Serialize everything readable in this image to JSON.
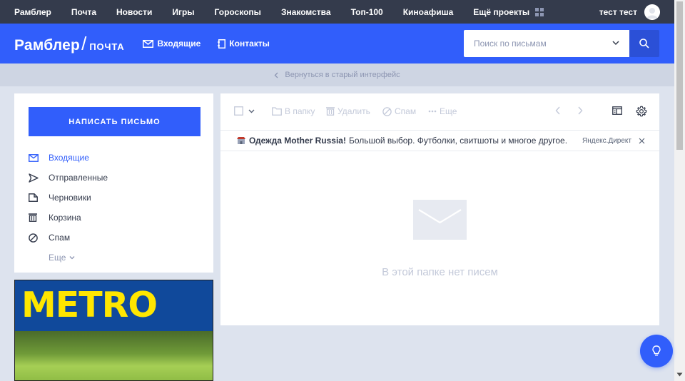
{
  "portal_bar": {
    "links": [
      "Рамблер",
      "Почта",
      "Новости",
      "Игры",
      "Гороскопы",
      "Знакомства",
      "Топ-100",
      "Киноафиша"
    ],
    "more_projects": "Ещё проекты",
    "user_name": "тест тест"
  },
  "header": {
    "logo_main": "Рамблер",
    "logo_slash": "/",
    "logo_sub": "почта",
    "nav_inbox": "Входящие",
    "nav_contacts": "Контакты",
    "search_placeholder": "Поиск по письмам"
  },
  "back_link": "Вернуться в старый интерфейс",
  "sidebar": {
    "compose": "НАПИСАТЬ ПИСЬМО",
    "folders": [
      {
        "label": "Входящие",
        "icon": "envelope-icon"
      },
      {
        "label": "Отправленные",
        "icon": "send-icon"
      },
      {
        "label": "Черновики",
        "icon": "draft-icon"
      },
      {
        "label": "Корзина",
        "icon": "trash-icon"
      },
      {
        "label": "Спам",
        "icon": "spam-icon"
      }
    ],
    "more": "Еще"
  },
  "ad_banner": {
    "text": "METRO"
  },
  "toolbar": {
    "to_folder": "В папку",
    "delete": "Удалить",
    "spam": "Спам",
    "more": "Еще"
  },
  "direct_ad": {
    "brand": "Одежда Mother Russia!",
    "text": "Большой выбор. Футболки, свитшоты и многое другое.",
    "source": "Яндекс.Директ"
  },
  "empty_message": "В этой папке нет писем",
  "colors": {
    "accent": "#315efb",
    "topbar": "#343b4c",
    "background": "#dde3ee",
    "muted": "#c3c9d9"
  }
}
